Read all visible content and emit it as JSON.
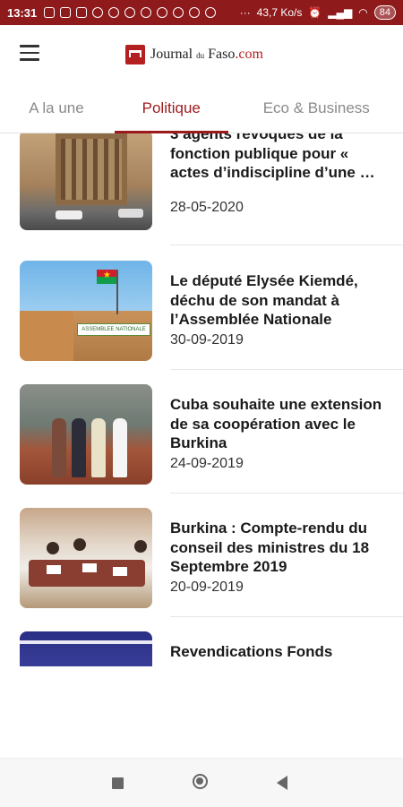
{
  "statusbar": {
    "time": "13:31",
    "network_speed": "43,7 Ko/s",
    "battery": "84"
  },
  "app": {
    "logo_part1": "Journal",
    "logo_part2": "du",
    "logo_part3": "Faso",
    "logo_part4": ".com"
  },
  "tabs": [
    {
      "label": "A la une"
    },
    {
      "label": "Politique"
    },
    {
      "label": "Eco & Business"
    }
  ],
  "articles": [
    {
      "title": "3 agents révoqués de la fonction publique pour « actes d’indiscipline d’une …",
      "date": "28-05-2020"
    },
    {
      "title": "Le député Elysée Kiemdé, déchu de son mandat à l’Assemblée Nationale",
      "date": "30-09-2019"
    },
    {
      "title": "Cuba souhaite une extension de sa coopération avec le Burkina",
      "date": "24-09-2019"
    },
    {
      "title": "Burkina : Compte-rendu du conseil des ministres du 18 Septembre 2019",
      "date": "20-09-2019"
    },
    {
      "title": "Revendications Fonds",
      "date": ""
    }
  ],
  "thumb_signs": {
    "assemblee": "ASSEMBLEE NATIONALE"
  }
}
